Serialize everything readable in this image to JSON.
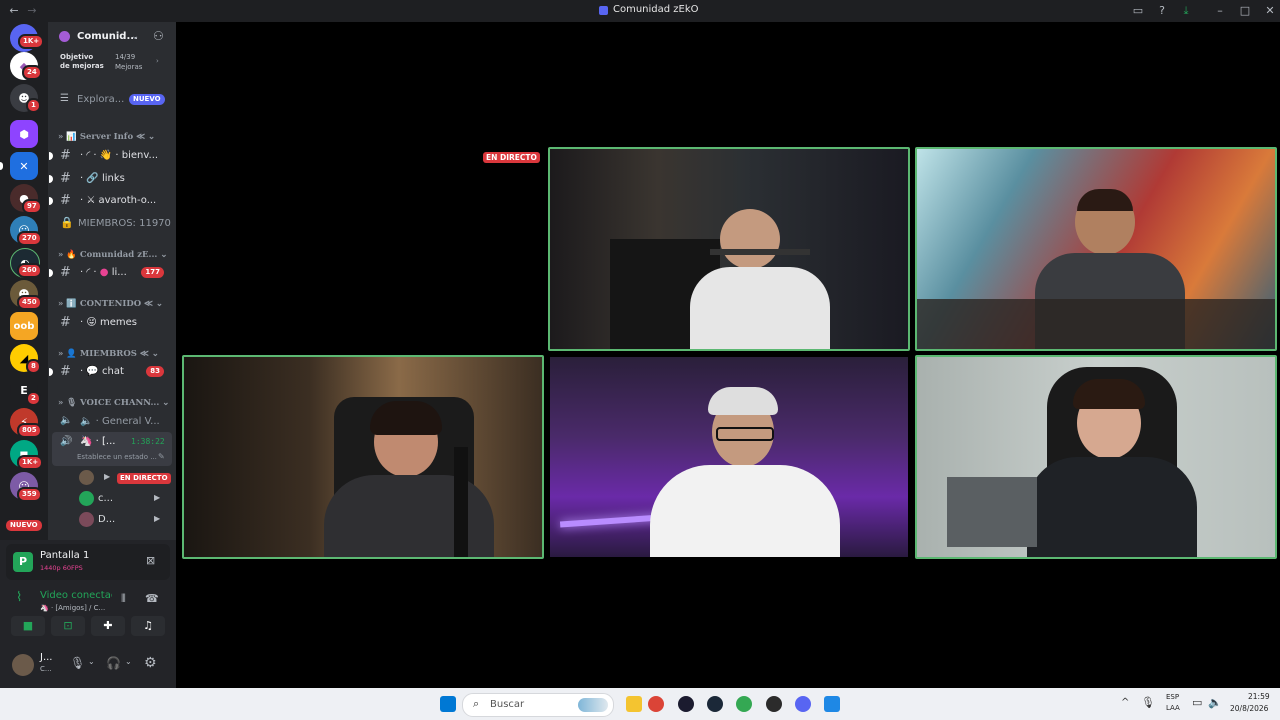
{
  "window": {
    "title": "Comunidad zEkO"
  },
  "rail": {
    "badges": [
      "1K+",
      "24",
      "1",
      "97",
      "270",
      "260",
      "450",
      "8",
      "2",
      "805",
      "1K+",
      "359"
    ],
    "server_letter": "E",
    "new_label": "NUEVO"
  },
  "server": {
    "name": "Comunid...",
    "boost_goal": "Objetivo de mejoras",
    "boost_count": "14/39",
    "boost_unit": "Mejoras"
  },
  "explore": {
    "label": "Explora...",
    "badge": "NUEVO"
  },
  "categories": {
    "server_info": "Server Info",
    "comunidad": "Comunidad zE...",
    "contenido": "CONTENIDO",
    "miembros": "MIEMBROS",
    "voice": "VOICE CHANN..."
  },
  "channels": {
    "bienvenida": "bienv...",
    "links": "links",
    "avaroth": "avaroth-o...",
    "members_count": "MIEMBROS: 11970",
    "li": "li...",
    "li_badge": "177",
    "memes": "memes",
    "chat": "chat",
    "chat_badge": "83",
    "general_voice": "General V...",
    "active_voice": "[...",
    "active_timer": "1:38:22",
    "status_placeholder": "Establece un estado ...",
    "live_label": "EN DIRECTO",
    "user_c": "c...",
    "user_d": "D..."
  },
  "stream_panel": {
    "title": "Pantalla 1",
    "quality": "1440p 60FPS"
  },
  "voice_panel": {
    "status": "Video conectac",
    "channel": "[Amigos] / C..."
  },
  "user_panel": {
    "name": "J...",
    "status": "C..."
  },
  "stage": {
    "live_label": "EN DIRECTO"
  },
  "taskbar": {
    "search_placeholder": "Buscar",
    "lang": "ESP",
    "lang_sub": "LAA",
    "time": "21:59",
    "date": "20/8/2026"
  },
  "colors": {
    "accent": "#5865f2",
    "live": "#da373c",
    "speaking": "#5cb872",
    "sidebar": "#2b2d31"
  }
}
